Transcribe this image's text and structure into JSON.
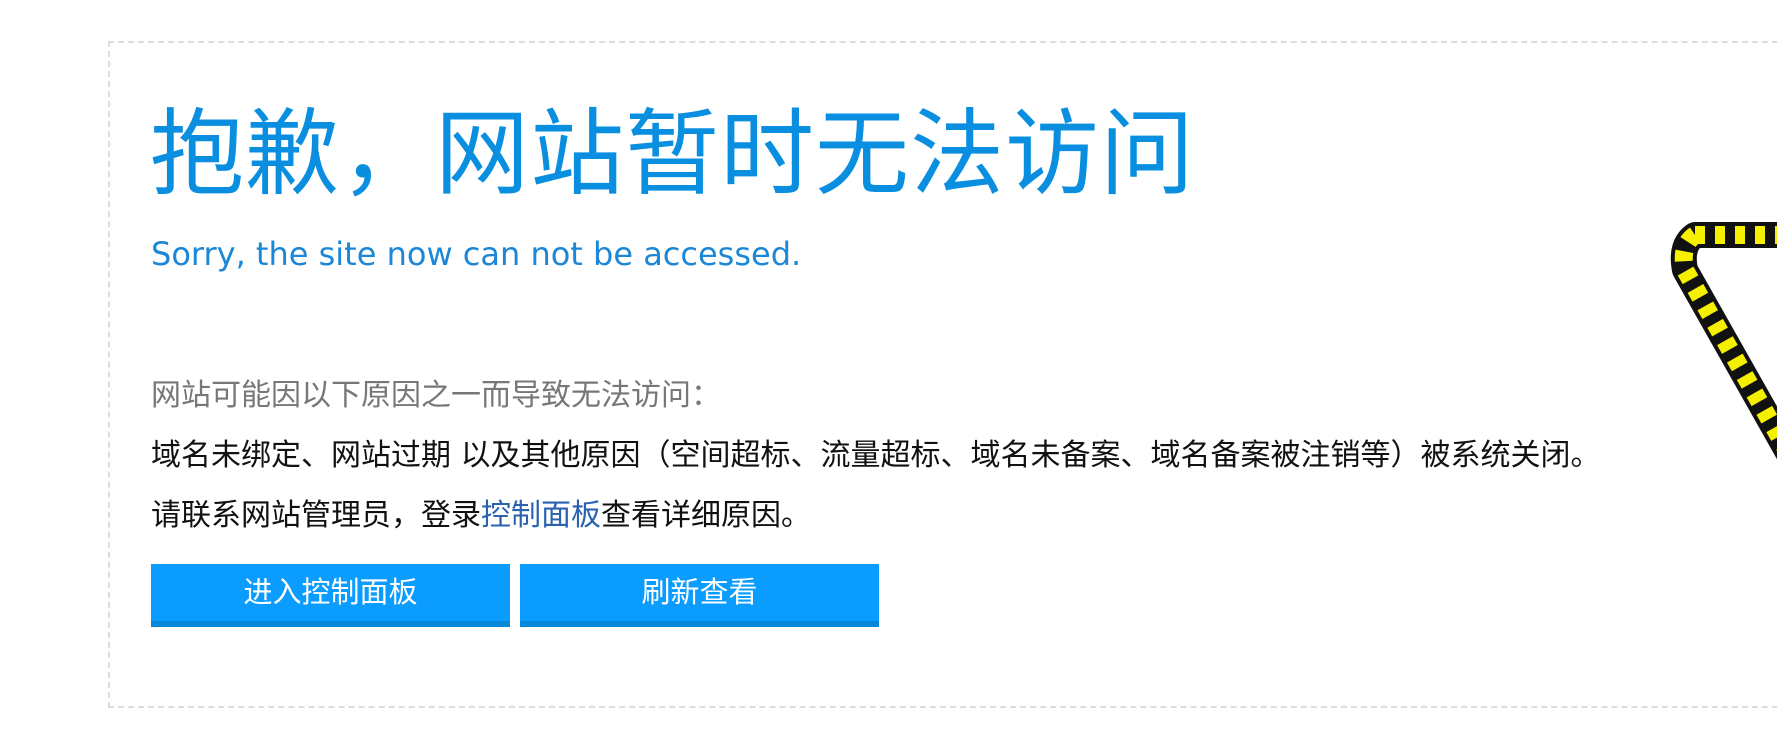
{
  "error": {
    "title": "抱歉，网站暂时无法访问",
    "subtitle": "Sorry, the site now can not be accessed.",
    "intro": "网站可能因以下原因之一而导致无法访问：",
    "reason": "域名未绑定、网站过期 以及其他原因（空间超标、流量超标、域名未备案、域名备案被注销等）被系统关闭。",
    "contact_prefix": "请联系网站管理员，登录",
    "contact_link": "控制面板",
    "contact_suffix": "查看详细原因。"
  },
  "buttons": {
    "panel": "进入控制面板",
    "refresh": "刷新查看"
  },
  "colors": {
    "title": "#0a8fe0",
    "button": "#0b9cff",
    "link": "#2a62b0",
    "warning_stripe_yellow": "#f5f000",
    "warning_stripe_black": "#111111"
  },
  "icons": {
    "warning": "warning-triangle-icon"
  }
}
